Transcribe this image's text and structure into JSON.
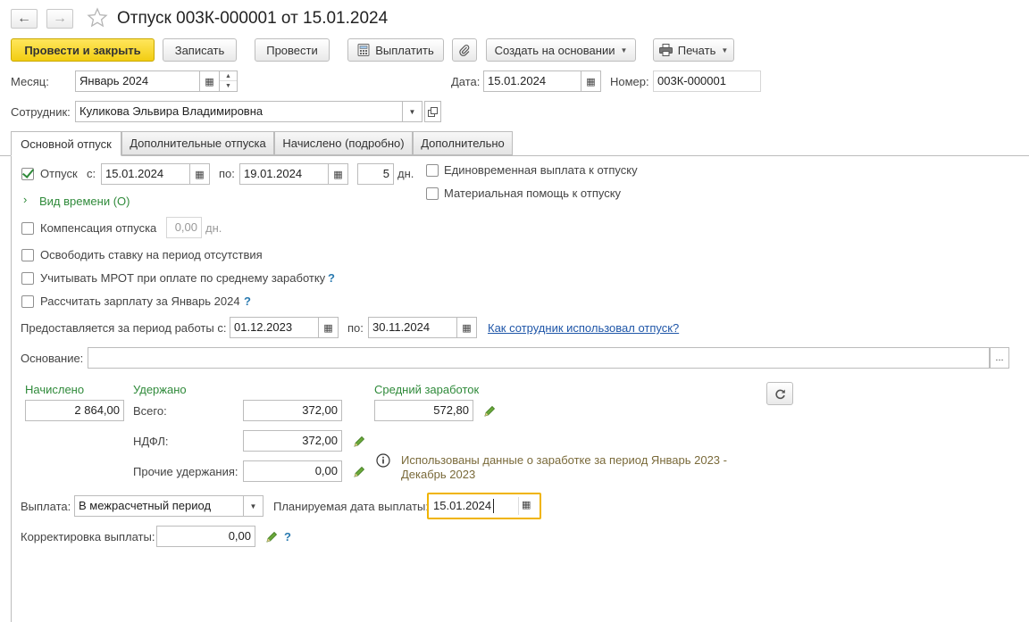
{
  "window": {
    "title": "Отпуск 003К-000001 от 15.01.2024"
  },
  "toolbar": {
    "post_close": "Провести и закрыть",
    "save": "Записать",
    "post": "Провести",
    "pay": "Выплатить",
    "create_based": "Создать на основании",
    "print": "Печать"
  },
  "header": {
    "month_label": "Месяц:",
    "month_value": "Январь 2024",
    "date_label": "Дата:",
    "date_value": "15.01.2024",
    "number_label": "Номер:",
    "number_value": "003К-000001",
    "employee_label": "Сотрудник:",
    "employee_value": "Куликова Эльвира Владимировна"
  },
  "tabs": [
    {
      "label": "Основной отпуск"
    },
    {
      "label": "Дополнительные отпуска"
    },
    {
      "label": "Начислено (подробно)"
    },
    {
      "label": "Дополнительно"
    }
  ],
  "main": {
    "vacation_label": "Отпуск",
    "from_label": "с:",
    "from_value": "15.01.2024",
    "to_label": "по:",
    "to_value": "19.01.2024",
    "days_value": "5",
    "days_unit": "дн.",
    "time_type_link": "Вид времени (О)",
    "lump_sum": "Единовременная выплата к отпуску",
    "material_aid": "Материальная помощь к отпуску",
    "compensation_label": "Компенсация отпуска",
    "compensation_value": "0,00",
    "compensation_unit": "дн.",
    "release_rate": "Освободить ставку на период отсутствия",
    "mrot": "Учитывать МРОТ при оплате по среднему заработку",
    "calc_salary": "Рассчитать зарплату за Январь 2024",
    "work_period_label": "Предоставляется за период работы с:",
    "work_from": "01.12.2023",
    "work_to_label": "по:",
    "work_to": "30.11.2024",
    "usage_link": "Как сотрудник использовал отпуск?",
    "basis_label": "Основание:",
    "basis_value": "",
    "basis_btn": "..."
  },
  "totals": {
    "accrued_label": "Начислено",
    "accrued_value": "2 864,00",
    "withheld_label": "Удержано",
    "total_label": "Всего:",
    "total_value": "372,00",
    "ndfl_label": "НДФЛ:",
    "ndfl_value": "372,00",
    "other_label": "Прочие удержания:",
    "other_value": "0,00",
    "avg_label": "Средний заработок",
    "avg_value": "572,80",
    "info_text_1": "Использованы данные о заработке за период Январь 2023 -",
    "info_text_2": "Декабрь 2023"
  },
  "payment": {
    "payout_label": "Выплата:",
    "payout_value": "В межрасчетный период",
    "plan_date_label": "Планируемая дата выплаты:",
    "plan_date_value": "15.01.2024",
    "correction_label": "Корректировка выплаты:",
    "correction_value": "0,00"
  },
  "colors": {
    "accent_yellow": "#f2cd12",
    "green_text": "#2f8a3a",
    "link": "#1f56a8",
    "focus_border": "#f0b400"
  }
}
